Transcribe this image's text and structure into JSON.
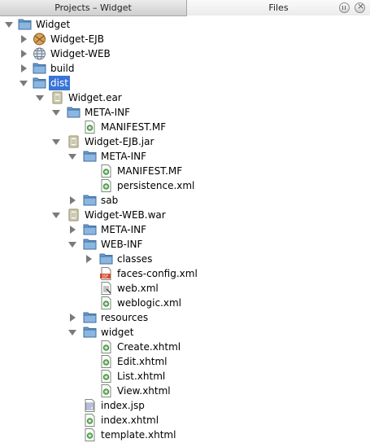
{
  "tabs": {
    "projects": "Projects – Widget",
    "files": "Files"
  },
  "tree": [
    {
      "label": "Widget",
      "icon": "folder",
      "toggle": "open",
      "depth": 0
    },
    {
      "label": "Widget-EJB",
      "icon": "ejb-module",
      "toggle": "closed",
      "depth": 1
    },
    {
      "label": "Widget-WEB",
      "icon": "web-module",
      "toggle": "closed",
      "depth": 1
    },
    {
      "label": "build",
      "icon": "folder",
      "toggle": "closed",
      "depth": 1
    },
    {
      "label": "dist",
      "icon": "folder",
      "toggle": "open",
      "depth": 1,
      "selected": true
    },
    {
      "label": "Widget.ear",
      "icon": "archive",
      "toggle": "open",
      "depth": 2
    },
    {
      "label": "META-INF",
      "icon": "folder",
      "toggle": "open",
      "depth": 3
    },
    {
      "label": "MANIFEST.MF",
      "icon": "xml-file",
      "toggle": "none",
      "depth": 4
    },
    {
      "label": "Widget-EJB.jar",
      "icon": "archive",
      "toggle": "open",
      "depth": 3
    },
    {
      "label": "META-INF",
      "icon": "folder",
      "toggle": "open",
      "depth": 4
    },
    {
      "label": "MANIFEST.MF",
      "icon": "xml-file",
      "toggle": "none",
      "depth": 5
    },
    {
      "label": "persistence.xml",
      "icon": "xml-file",
      "toggle": "none",
      "depth": 5
    },
    {
      "label": "sab",
      "icon": "folder",
      "toggle": "closed",
      "depth": 4
    },
    {
      "label": "Widget-WEB.war",
      "icon": "archive",
      "toggle": "open",
      "depth": 3
    },
    {
      "label": "META-INF",
      "icon": "folder",
      "toggle": "closed",
      "depth": 4
    },
    {
      "label": "WEB-INF",
      "icon": "folder",
      "toggle": "open",
      "depth": 4
    },
    {
      "label": "classes",
      "icon": "folder",
      "toggle": "closed",
      "depth": 5
    },
    {
      "label": "faces-config.xml",
      "icon": "jsf-config",
      "toggle": "none",
      "depth": 5
    },
    {
      "label": "web.xml",
      "icon": "web-xml",
      "toggle": "none",
      "depth": 5
    },
    {
      "label": "weblogic.xml",
      "icon": "xml-file",
      "toggle": "none",
      "depth": 5
    },
    {
      "label": "resources",
      "icon": "folder",
      "toggle": "closed",
      "depth": 4
    },
    {
      "label": "widget",
      "icon": "folder",
      "toggle": "open",
      "depth": 4
    },
    {
      "label": "Create.xhtml",
      "icon": "xml-file",
      "toggle": "none",
      "depth": 5
    },
    {
      "label": "Edit.xhtml",
      "icon": "xml-file",
      "toggle": "none",
      "depth": 5
    },
    {
      "label": "List.xhtml",
      "icon": "xml-file",
      "toggle": "none",
      "depth": 5
    },
    {
      "label": "View.xhtml",
      "icon": "xml-file",
      "toggle": "none",
      "depth": 5
    },
    {
      "label": "index.jsp",
      "icon": "jsp-file",
      "toggle": "none",
      "depth": 4
    },
    {
      "label": "index.xhtml",
      "icon": "xml-file",
      "toggle": "none",
      "depth": 4
    },
    {
      "label": "template.xhtml",
      "icon": "xml-file",
      "toggle": "none",
      "depth": 4
    }
  ],
  "colors": {
    "folder": "#5f95c7",
    "selection": "#3875d7"
  }
}
